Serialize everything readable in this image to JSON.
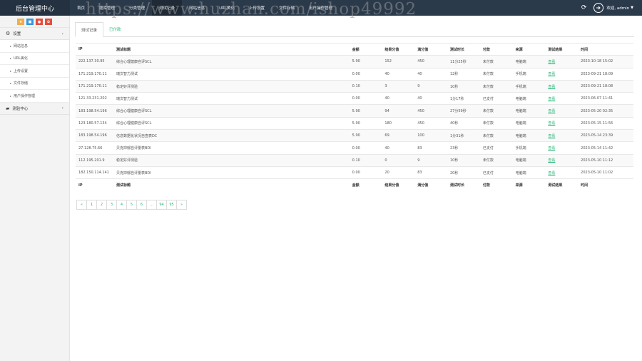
{
  "app": {
    "brand": "后台管理中心",
    "watermark": "https://www.huzhan.com/ishop49992"
  },
  "nav": {
    "items": [
      {
        "label": "首页"
      },
      {
        "label": "题库管理"
      },
      {
        "label": "分类管理"
      },
      {
        "label": "测试记录"
      },
      {
        "label": "网站信息"
      },
      {
        "label": "URL美化"
      },
      {
        "label": "上传设置"
      },
      {
        "label": "文件存储"
      },
      {
        "label": "用户操作管理"
      }
    ],
    "active_index": 3,
    "user": {
      "welcome": "欢迎, admin"
    }
  },
  "sidebar": {
    "shortcut_colors": [
      "#f0ad4e",
      "#3498db",
      "#e74c3c",
      "#e74c3c"
    ],
    "settings_label": "设置",
    "sub_items": [
      {
        "label": "网站信息"
      },
      {
        "label": "URL美化"
      },
      {
        "label": "上传设置"
      },
      {
        "label": "文件存储"
      },
      {
        "label": "用户操作管理"
      }
    ],
    "test_center_label": "测验中心"
  },
  "tabs": [
    {
      "label": "测试记录"
    },
    {
      "label": "已付款"
    }
  ],
  "table": {
    "headers": [
      "IP",
      "测试标题",
      "金额",
      "结果分值",
      "满分值",
      "测试时长",
      "付款",
      "来源",
      "测试结果",
      "时间"
    ],
    "rows": [
      [
        "222.137.30.95",
        "综合心理健康自评SCL",
        "5.90",
        "152",
        "450",
        "11分25秒",
        "未付款",
        "电脑端",
        "查看",
        "2023-10-18 15:02"
      ],
      [
        "171.219.170.11",
        "瑞文智力测试",
        "0.00",
        "40",
        "40",
        "12秒",
        "未付款",
        "手机端",
        "查看",
        "2023-09-21 18:09"
      ],
      [
        "171.219.170.11",
        "稳定好评测验",
        "0.10",
        "3",
        "9",
        "10秒",
        "未付款",
        "手机端",
        "查看",
        "2023-09-21 18:08"
      ],
      [
        "121.33.231.202",
        "瑞文智力测试",
        "0.00",
        "40",
        "40",
        "1分17秒",
        "已支付",
        "电脑端",
        "查看",
        "2023-06-07 11:41"
      ],
      [
        "183.198.54.196",
        "综合心理健康自评SCL",
        "5.90",
        "94",
        "450",
        "27分59秒",
        "未付款",
        "电脑端",
        "查看",
        "2023-05-20 02:35"
      ],
      [
        "123.180.57.134",
        "综合心理健康自评SCL",
        "5.90",
        "180",
        "450",
        "40秒",
        "未付款",
        "电脑端",
        "查看",
        "2023-05-15 11:56"
      ],
      [
        "183.198.54.196",
        "信息数据化状况自查表DC",
        "5.90",
        "69",
        "100",
        "1分31秒",
        "未付款",
        "电脑端",
        "查看",
        "2023-05-14 23:39"
      ],
      [
        "27.128.75.66",
        "贝克抑郁自评量表BDI",
        "0.00",
        "40",
        "83",
        "23秒",
        "已支付",
        "手机端",
        "查看",
        "2023-05-14 11:42"
      ],
      [
        "112.195.201.9",
        "稳定好评测验",
        "0.10",
        "0",
        "9",
        "10秒",
        "未付款",
        "电脑端",
        "查看",
        "2023-05-10 11:12"
      ],
      [
        "182.150.114.141",
        "贝克抑郁自评量表BDI",
        "0.00",
        "20",
        "83",
        "20秒",
        "已支付",
        "电脑端",
        "查看",
        "2023-05-10 11:02"
      ]
    ]
  },
  "pagination": {
    "prev": "«",
    "pages": [
      "1",
      "2",
      "3",
      "4",
      "5",
      "6",
      "...",
      "94",
      "95"
    ],
    "next": "»"
  }
}
